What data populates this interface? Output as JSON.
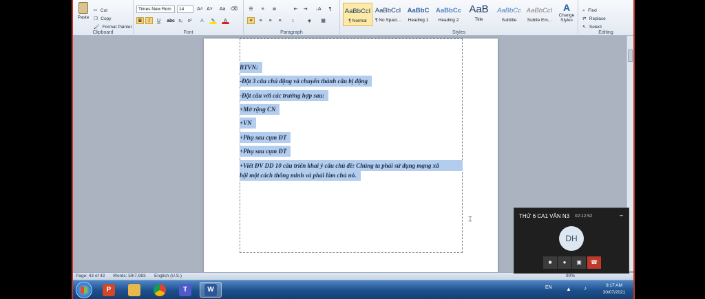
{
  "ribbon": {
    "clipboard": {
      "paste": "Paste",
      "cut": "Cut",
      "copy": "Copy",
      "format_painter": "Format Painter",
      "label": "Clipboard"
    },
    "font": {
      "name": "Times New Rom",
      "size": "14",
      "label": "Font",
      "grow": "A˄",
      "shrink": "A˅",
      "case": "Aa",
      "bold": "B",
      "italic": "I",
      "underline": "U",
      "strike": "abc",
      "subscript": "x₂",
      "superscript": "x²"
    },
    "paragraph": {
      "label": "Paragraph",
      "sort": "↓A",
      "pilcrow": "¶"
    },
    "styles": {
      "label": "Styles",
      "items": [
        {
          "sample": "AaBbCcI",
          "name": "¶ Normal"
        },
        {
          "sample": "AaBbCcI",
          "name": "¶ No Spaci..."
        },
        {
          "sample": "AaBbC",
          "name": "Heading 1"
        },
        {
          "sample": "AaBbCc",
          "name": "Heading 2"
        },
        {
          "sample": "AaB",
          "name": "Title"
        },
        {
          "sample": "AaBbCc",
          "name": "Subtitle"
        },
        {
          "sample": "AaBbCcI",
          "name": "Subtle Em..."
        }
      ],
      "change": "Change Styles"
    },
    "editing": {
      "find": "Find",
      "replace": "Replace",
      "select": "Select",
      "label": "Editing"
    }
  },
  "document": {
    "lines": [
      "BTVN:",
      "-Đặt 3 câu chủ động và chuyển thành câu bị động",
      "-Đặt câu với các trường hợp sau:",
      "+Mở rộng CN",
      "+VN",
      "+Phụ sau cụm ĐT",
      "+Phụ sau cụm ĐT",
      "+Viết ĐV DD 10 câu triển khai ý câu chủ đề: Chúng ta phải sử dụng mạng xã",
      "hội một cách thông minh và phải làm chủ nó."
    ]
  },
  "status": {
    "page": "Page: 43 of 43",
    "words": "Words: 59/7,983",
    "language": "English (U.S.)",
    "zoom": "90%"
  },
  "call": {
    "title": "THỨ 6 CA1 VĂN N3",
    "time": "02:12:52",
    "avatar": "DH",
    "minimize": "–"
  },
  "tray": {
    "lang": "EN",
    "time": "9:17 AM",
    "date": "30/07/2021"
  },
  "colors": {
    "selection": "#b3cdee",
    "end_call": "#c0392b",
    "taskbar": "#1c4f8c"
  }
}
